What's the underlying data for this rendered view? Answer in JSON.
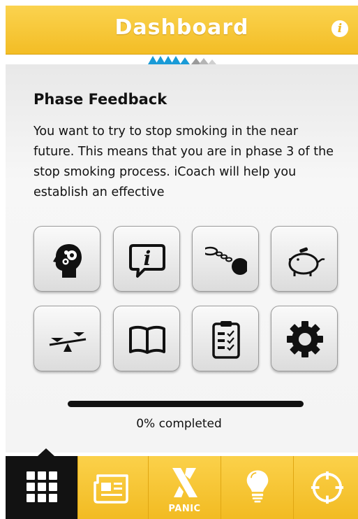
{
  "header": {
    "title": "Dashboard",
    "info_icon": "info-icon"
  },
  "brand_logo_colors": [
    "#1a9bd7",
    "#9a9a9a"
  ],
  "main": {
    "section_title": "Phase Feedback",
    "feedback_text": "You want to try to stop smoking in the near future. This means that you are in phase 3 of the stop smoking process. iCoach will help you establish an effective"
  },
  "tiles": [
    {
      "icon": "head-gears-icon"
    },
    {
      "icon": "info-speech-icon"
    },
    {
      "icon": "ball-and-chain-icon"
    },
    {
      "icon": "piggy-bank-icon"
    },
    {
      "icon": "balance-scale-icon"
    },
    {
      "icon": "book-icon"
    },
    {
      "icon": "checklist-clipboard-icon"
    },
    {
      "icon": "gear-icon"
    }
  ],
  "progress": {
    "percent": 0,
    "label": "0% completed"
  },
  "tabbar": {
    "tabs": [
      {
        "icon": "grid-icon",
        "active": true
      },
      {
        "icon": "newspaper-icon",
        "active": false
      },
      {
        "icon": "panic-x-icon",
        "label": "PANIC",
        "active": false
      },
      {
        "icon": "lightbulb-icon",
        "active": false
      },
      {
        "icon": "target-icon",
        "active": false
      }
    ]
  },
  "colors": {
    "accent": "#f3bd25",
    "dark": "#121212",
    "tile_bg": "#e6e6e6"
  }
}
